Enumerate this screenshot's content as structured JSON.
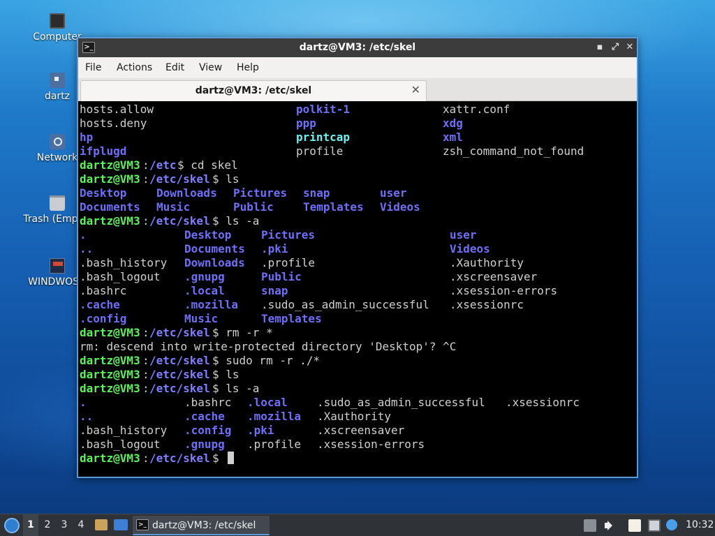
{
  "desktop": {
    "icons": [
      {
        "label": "Computer",
        "icon": "computer-icon"
      },
      {
        "label": "dartz",
        "icon": "home-folder-icon"
      },
      {
        "label": "Network",
        "icon": "network-icon"
      },
      {
        "label": "Trash (Empty)",
        "icon": "trash-icon"
      },
      {
        "label": "WINDWOSD",
        "icon": "drive-icon"
      }
    ]
  },
  "window": {
    "title": "dartz@VM3: /etc/skel",
    "app_icon_glyph": ">_",
    "controls": {
      "minimize": "▪",
      "maximize": "⤢",
      "close": "✕"
    },
    "menu": [
      "File",
      "Actions",
      "Edit",
      "View",
      "Help"
    ],
    "tab": {
      "label": "dartz@VM3: /etc/skel",
      "close": "✕"
    }
  },
  "terminal": {
    "prompt_user": "dartz@VM3",
    "lines": [
      [
        {
          "t": "hosts.allow",
          "c": "def",
          "col": 0
        },
        {
          "t": "polkit-1",
          "c": "dir",
          "col": 31
        },
        {
          "t": "xattr.conf",
          "c": "def",
          "col": 52
        }
      ],
      [
        {
          "t": "hosts.deny",
          "c": "def",
          "col": 0
        },
        {
          "t": "ppp",
          "c": "dir",
          "col": 31
        },
        {
          "t": "xdg",
          "c": "dir",
          "col": 52
        }
      ],
      [
        {
          "t": "hp",
          "c": "dir",
          "col": 0
        },
        {
          "t": "printcap",
          "c": "cyan",
          "col": 31
        },
        {
          "t": "xml",
          "c": "dir",
          "col": 52
        }
      ],
      [
        {
          "t": "ifplugd",
          "c": "dir",
          "col": 0
        },
        {
          "t": "profile",
          "c": "def",
          "col": 31
        },
        {
          "t": "zsh_command_not_found",
          "c": "def",
          "col": 52
        }
      ],
      [
        {
          "t": "dartz@VM3",
          "c": "user",
          "col": 0
        },
        {
          "t": ":",
          "c": "def",
          "col": 9
        },
        {
          "t": "/etc",
          "c": "path",
          "col": 10
        },
        {
          "t": "$ cd skel",
          "c": "def",
          "col": 14
        }
      ],
      [
        {
          "t": "dartz@VM3",
          "c": "user",
          "col": 0
        },
        {
          "t": ":",
          "c": "def",
          "col": 9
        },
        {
          "t": "/etc/skel",
          "c": "path",
          "col": 10
        },
        {
          "t": "$ ls",
          "c": "def",
          "col": 19
        }
      ],
      [
        {
          "t": "Desktop",
          "c": "dir",
          "col": 0
        },
        {
          "t": "Downloads",
          "c": "dir",
          "col": 11
        },
        {
          "t": "Pictures",
          "c": "dir",
          "col": 22
        },
        {
          "t": "snap",
          "c": "dir",
          "col": 32
        },
        {
          "t": "user",
          "c": "dir",
          "col": 43
        }
      ],
      [
        {
          "t": "Documents",
          "c": "dir",
          "col": 0
        },
        {
          "t": "Music",
          "c": "dir",
          "col": 11
        },
        {
          "t": "Public",
          "c": "dir",
          "col": 22
        },
        {
          "t": "Templates",
          "c": "dir",
          "col": 32
        },
        {
          "t": "Videos",
          "c": "dir",
          "col": 43
        }
      ],
      [
        {
          "t": "dartz@VM3",
          "c": "user",
          "col": 0
        },
        {
          "t": ":",
          "c": "def",
          "col": 9
        },
        {
          "t": "/etc/skel",
          "c": "path",
          "col": 10
        },
        {
          "t": "$ ls -a",
          "c": "def",
          "col": 19
        }
      ],
      [
        {
          "t": ".",
          "c": "dir",
          "col": 0
        },
        {
          "t": "Desktop",
          "c": "dir",
          "col": 15
        },
        {
          "t": "Pictures",
          "c": "dir",
          "col": 26
        },
        {
          "t": "user",
          "c": "dir",
          "col": 53
        }
      ],
      [
        {
          "t": "..",
          "c": "dir",
          "col": 0
        },
        {
          "t": "Documents",
          "c": "dir",
          "col": 15
        },
        {
          "t": ".pki",
          "c": "dir",
          "col": 26
        },
        {
          "t": "Videos",
          "c": "dir",
          "col": 53
        }
      ],
      [
        {
          "t": ".bash_history",
          "c": "def",
          "col": 0
        },
        {
          "t": "Downloads",
          "c": "dir",
          "col": 15
        },
        {
          "t": ".profile",
          "c": "def",
          "col": 26
        },
        {
          "t": ".Xauthority",
          "c": "def",
          "col": 53
        }
      ],
      [
        {
          "t": ".bash_logout",
          "c": "def",
          "col": 0
        },
        {
          "t": ".gnupg",
          "c": "dir",
          "col": 15
        },
        {
          "t": "Public",
          "c": "dir",
          "col": 26
        },
        {
          "t": ".xscreensaver",
          "c": "def",
          "col": 53
        }
      ],
      [
        {
          "t": ".bashrc",
          "c": "def",
          "col": 0
        },
        {
          "t": ".local",
          "c": "dir",
          "col": 15
        },
        {
          "t": "snap",
          "c": "dir",
          "col": 26
        },
        {
          "t": ".xsession-errors",
          "c": "def",
          "col": 53
        }
      ],
      [
        {
          "t": ".cache",
          "c": "dir",
          "col": 0
        },
        {
          "t": ".mozilla",
          "c": "dir",
          "col": 15
        },
        {
          "t": ".sudo_as_admin_successful",
          "c": "def",
          "col": 26
        },
        {
          "t": ".xsessionrc",
          "c": "def",
          "col": 53
        }
      ],
      [
        {
          "t": ".config",
          "c": "dir",
          "col": 0
        },
        {
          "t": "Music",
          "c": "dir",
          "col": 15
        },
        {
          "t": "Templates",
          "c": "dir",
          "col": 26
        }
      ],
      [
        {
          "t": "dartz@VM3",
          "c": "user",
          "col": 0
        },
        {
          "t": ":",
          "c": "def",
          "col": 9
        },
        {
          "t": "/etc/skel",
          "c": "path",
          "col": 10
        },
        {
          "t": "$ rm -r *",
          "c": "def",
          "col": 19
        }
      ],
      [
        {
          "t": "rm: descend into write-protected directory 'Desktop'? ^C",
          "c": "def",
          "col": 0
        }
      ],
      [
        {
          "t": "dartz@VM3",
          "c": "user",
          "col": 0
        },
        {
          "t": ":",
          "c": "def",
          "col": 9
        },
        {
          "t": "/etc/skel",
          "c": "path",
          "col": 10
        },
        {
          "t": "$ sudo rm -r ./*",
          "c": "def",
          "col": 19
        }
      ],
      [
        {
          "t": "dartz@VM3",
          "c": "user",
          "col": 0
        },
        {
          "t": ":",
          "c": "def",
          "col": 9
        },
        {
          "t": "/etc/skel",
          "c": "path",
          "col": 10
        },
        {
          "t": "$ ls",
          "c": "def",
          "col": 19
        }
      ],
      [
        {
          "t": "dartz@VM3",
          "c": "user",
          "col": 0
        },
        {
          "t": ":",
          "c": "def",
          "col": 9
        },
        {
          "t": "/etc/skel",
          "c": "path",
          "col": 10
        },
        {
          "t": "$ ls -a",
          "c": "def",
          "col": 19
        }
      ],
      [
        {
          "t": ".",
          "c": "dir",
          "col": 0
        },
        {
          "t": ".bashrc",
          "c": "def",
          "col": 15
        },
        {
          "t": ".local",
          "c": "dir",
          "col": 24
        },
        {
          "t": ".sudo_as_admin_successful",
          "c": "def",
          "col": 34
        },
        {
          "t": ".xsessionrc",
          "c": "def",
          "col": 61
        }
      ],
      [
        {
          "t": "..",
          "c": "dir",
          "col": 0
        },
        {
          "t": ".cache",
          "c": "dir",
          "col": 15
        },
        {
          "t": ".mozilla",
          "c": "dir",
          "col": 24
        },
        {
          "t": ".Xauthority",
          "c": "def",
          "col": 34
        }
      ],
      [
        {
          "t": ".bash_history",
          "c": "def",
          "col": 0
        },
        {
          "t": ".config",
          "c": "dir",
          "col": 15
        },
        {
          "t": ".pki",
          "c": "dir",
          "col": 24
        },
        {
          "t": ".xscreensaver",
          "c": "def",
          "col": 34
        }
      ],
      [
        {
          "t": ".bash_logout",
          "c": "def",
          "col": 0
        },
        {
          "t": ".gnupg",
          "c": "dir",
          "col": 15
        },
        {
          "t": ".profile",
          "c": "def",
          "col": 24
        },
        {
          "t": ".xsession-errors",
          "c": "def",
          "col": 34
        }
      ],
      [
        {
          "t": "dartz@VM3",
          "c": "user",
          "col": 0
        },
        {
          "t": ":",
          "c": "def",
          "col": 9
        },
        {
          "t": "/etc/skel",
          "c": "path",
          "col": 10
        },
        {
          "t": "$ ",
          "c": "def",
          "col": 19
        }
      ]
    ],
    "colors": {
      "user": "#5ff05f",
      "path": "#7f7fff",
      "dir": "#6f6ff8",
      "exec": "#6ff0f0",
      "text": "#d0d0d0"
    }
  },
  "taskbar": {
    "workspaces": [
      "1",
      "2",
      "3",
      "4"
    ],
    "active_workspace": "1",
    "task_label": "dartz@VM3: /etc/skel",
    "task_icon_glyph": ">_",
    "clock": "10:32"
  }
}
